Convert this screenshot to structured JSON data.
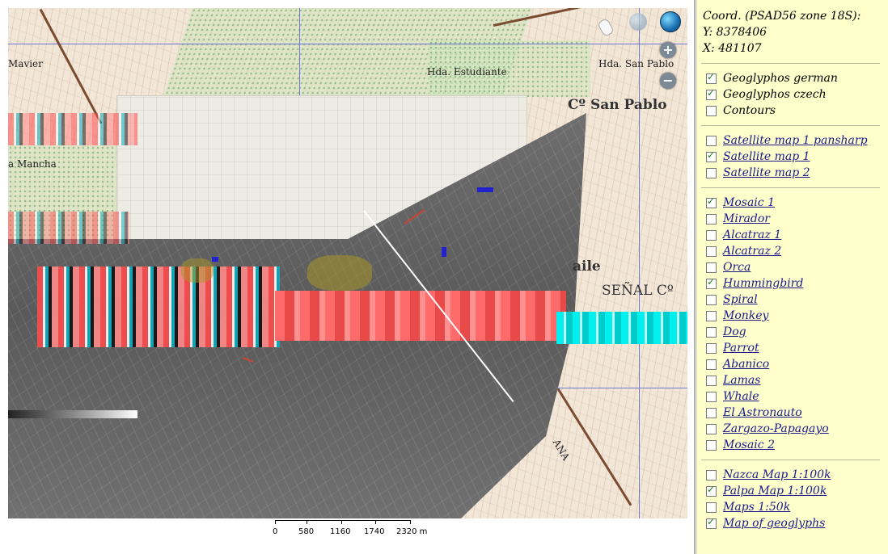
{
  "coordinates": {
    "title": "Coord. (PSAD56 zone 18S):",
    "y": "Y: 8378406",
    "x": "X: 481107"
  },
  "map": {
    "labels": {
      "mavier": "Mavier",
      "mancha": "a Mancha",
      "hda_san_pablo": "Hda. San Pablo",
      "hda_estudiante": "Hda. Estudiante",
      "co_san_pablo": "Cº San Pablo",
      "senal": "SEÑAL Cº",
      "aile": "aile",
      "ana": "ANA"
    },
    "controls": {
      "zoom_in": "+",
      "zoom_out": "−"
    },
    "scale": {
      "ticks": [
        "0",
        "580",
        "1160",
        "1740",
        "2320 m"
      ]
    }
  },
  "layers": {
    "vector": [
      {
        "label": "Geoglyphos german",
        "checked": true,
        "link": false
      },
      {
        "label": "Geoglyphos czech",
        "checked": true,
        "link": false
      },
      {
        "label": "Contours",
        "checked": false,
        "link": false
      }
    ],
    "satellite": [
      {
        "label": "Satellite map 1 pansharp",
        "checked": false,
        "link": true
      },
      {
        "label": "Satellite map 1",
        "checked": true,
        "link": true
      },
      {
        "label": "Satellite map 2",
        "checked": false,
        "link": true
      }
    ],
    "mosaics": [
      {
        "label": "Mosaic 1",
        "checked": true,
        "link": true
      },
      {
        "label": "Mirador",
        "checked": false,
        "link": true
      },
      {
        "label": "Alcatraz 1",
        "checked": false,
        "link": true
      },
      {
        "label": "Alcatraz 2",
        "checked": false,
        "link": true
      },
      {
        "label": "Orca",
        "checked": false,
        "link": true
      },
      {
        "label": "Hummingbird",
        "checked": true,
        "link": true
      },
      {
        "label": "Spiral",
        "checked": false,
        "link": true
      },
      {
        "label": "Monkey",
        "checked": false,
        "link": true
      },
      {
        "label": "Dog",
        "checked": false,
        "link": true
      },
      {
        "label": "Parrot",
        "checked": false,
        "link": true
      },
      {
        "label": "Abanico",
        "checked": false,
        "link": true
      },
      {
        "label": "Lamas",
        "checked": false,
        "link": true
      },
      {
        "label": "Whale",
        "checked": false,
        "link": true
      },
      {
        "label": "El Astronauto",
        "checked": false,
        "link": true
      },
      {
        "label": "Zargazo-Papagayo",
        "checked": false,
        "link": true
      },
      {
        "label": "Mosaic 2",
        "checked": false,
        "link": true
      }
    ],
    "maps": [
      {
        "label": "Nazca Map 1:100k",
        "checked": false,
        "link": true
      },
      {
        "label": "Palpa Map 1:100k",
        "checked": true,
        "link": true
      },
      {
        "label": "Maps 1:50k",
        "checked": false,
        "link": true
      },
      {
        "label": "Map of geoglyphs",
        "checked": true,
        "link": true
      }
    ]
  }
}
